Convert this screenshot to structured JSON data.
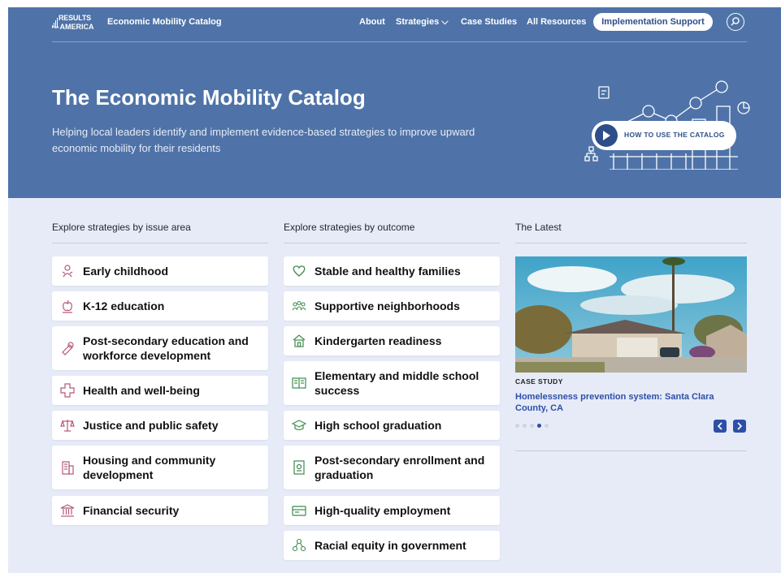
{
  "header": {
    "logo": {
      "line1": "RESULTS",
      "line2_prefix": "FOR",
      "line2": "AMERICA"
    },
    "brand": "Economic Mobility Catalog",
    "nav": [
      {
        "label": "About"
      },
      {
        "label": "Strategies ⌵"
      },
      {
        "label": "Case Studies"
      },
      {
        "label": "All Resources"
      }
    ],
    "cta": "Implementation Support",
    "search_icon": "search-icon"
  },
  "hero": {
    "title": "The Economic Mobility Catalog",
    "subtitle": "Helping local leaders identify and implement evidence-based strategies to improve upward economic mobility for their residents",
    "howto_label": "HOW TO USE THE CATALOG",
    "play_icon": "play-icon"
  },
  "issue_area": {
    "heading": "Explore strategies by issue area",
    "items": [
      {
        "label": "Early childhood",
        "icon": "baby-icon"
      },
      {
        "label": "K-12 education",
        "icon": "apple-icon"
      },
      {
        "label": "Post-secondary education and workforce development",
        "icon": "diploma-icon"
      },
      {
        "label": "Health and well-being",
        "icon": "medical-cross-icon"
      },
      {
        "label": "Justice and public safety",
        "icon": "scales-icon"
      },
      {
        "label": "Housing and community development",
        "icon": "building-icon"
      },
      {
        "label": "Financial security",
        "icon": "bank-icon"
      }
    ]
  },
  "outcome": {
    "heading": "Explore strategies by outcome",
    "items": [
      {
        "label": "Stable and healthy families",
        "icon": "heart-icon"
      },
      {
        "label": "Supportive neighborhoods",
        "icon": "people-icon"
      },
      {
        "label": "Kindergarten readiness",
        "icon": "schoolhouse-icon"
      },
      {
        "label": "Elementary and middle school success",
        "icon": "book-icon"
      },
      {
        "label": "High school graduation",
        "icon": "grad-cap-icon"
      },
      {
        "label": "Post-secondary enrollment and graduation",
        "icon": "certificate-icon"
      },
      {
        "label": "High-quality employment",
        "icon": "id-card-icon"
      },
      {
        "label": "Racial equity in government",
        "icon": "linked-people-icon"
      }
    ]
  },
  "latest": {
    "heading": "The Latest",
    "type": "CASE STUDY",
    "title": "Homelessness prevention system: Santa Clara County, CA",
    "slide_count": 5,
    "active_slide": 4
  },
  "colors": {
    "hero_bg": "#4f73a8",
    "page_bg": "#e6ebf7",
    "accent": "#2e4fa8",
    "issue_icon": "#b5577a",
    "outcome_icon": "#3f8a4e"
  }
}
